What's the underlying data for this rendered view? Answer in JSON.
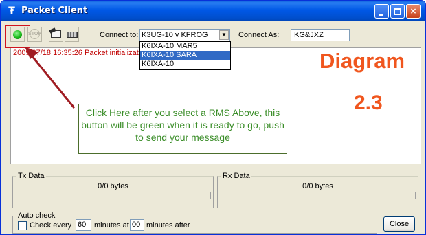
{
  "window": {
    "title": "Packet Client",
    "app_icon": "antenna-icon",
    "title_buttons": {
      "minimize": "minimize-icon",
      "maximize": "maximize-icon",
      "close": "×"
    }
  },
  "toolbar": {
    "connect_button_icon": "green-light-icon",
    "stop_button_label": "STOP",
    "compose_icon": "compose-mail-icon",
    "keyboard_icon": "keyboard-icon",
    "connect_to_label": "Connect to:",
    "connect_to_value": "K3UG-10 v KFROG",
    "connect_as_label": "Connect As:",
    "connect_as_value": "KG&JXZ"
  },
  "dropdown": {
    "options": [
      "K6IXA-10 MAR5",
      "K6IXA-10 SARA",
      "K6IXA-10"
    ],
    "selected_index": 1
  },
  "log": {
    "lines": [
      "2009/07/18 16:35:26 Packet initialization..."
    ]
  },
  "annotation": {
    "diagram_label": "Diagram",
    "diagram_number": "2.3",
    "callout_text": "Click Here after you select a RMS Above, this button will be green when it is ready to go,  push to send your message",
    "colors": {
      "diagram": "#f0561e",
      "callout_text": "#3a8d28",
      "arrow": "#a01c22"
    }
  },
  "tx": {
    "label": "Tx Data",
    "bytes": "0/0 bytes",
    "progress": 0
  },
  "rx": {
    "label": "Rx Data",
    "bytes": "0/0 bytes",
    "progress": 0
  },
  "auto_check": {
    "label": "Auto check",
    "checked": false,
    "check_every_label": "Check every",
    "minutes_value": "60",
    "minutes_at_label": "minutes at",
    "at_value": "00",
    "minutes_after_label": "minutes after"
  },
  "close_button_label": "Close"
}
